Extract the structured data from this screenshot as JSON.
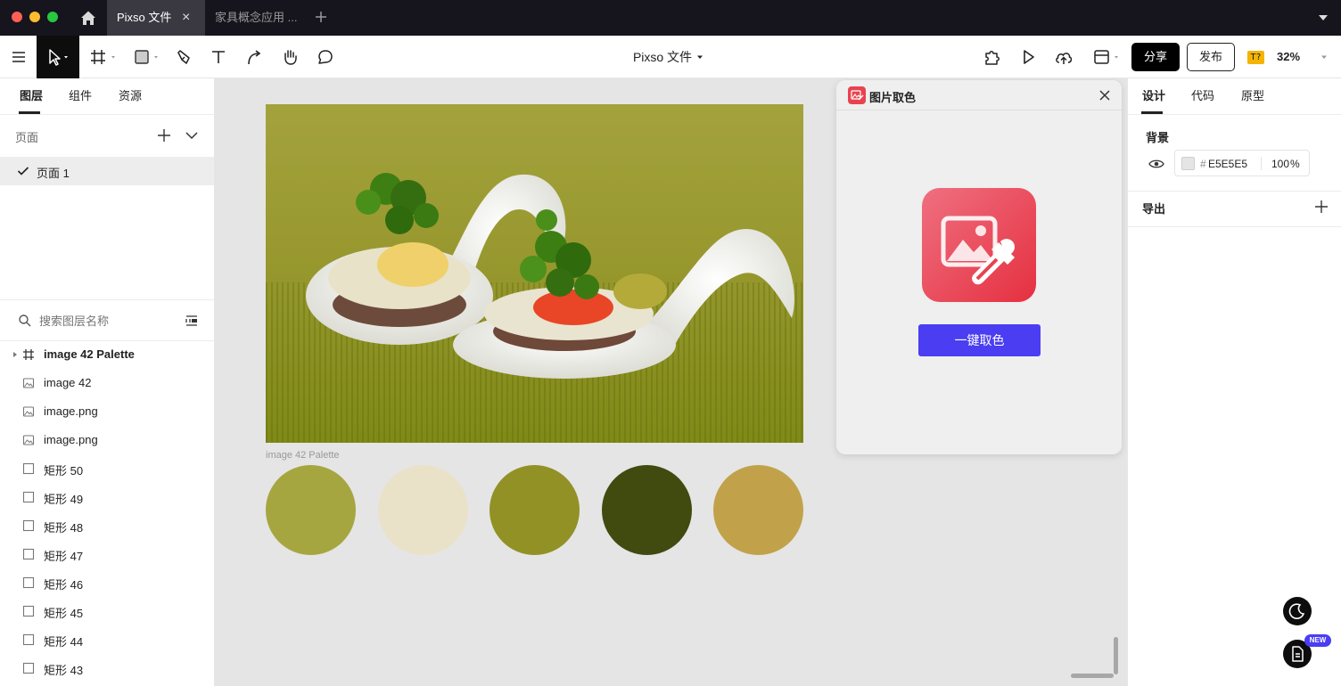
{
  "titlebar": {
    "tabs": [
      {
        "label": "Pixso 文件",
        "active": true
      },
      {
        "label": "家具概念应用 ...",
        "active": false
      }
    ]
  },
  "toolbar": {
    "file_title": "Pixso 文件",
    "share_label": "分享",
    "publish_label": "发布",
    "badge": "T?",
    "zoom": "32%"
  },
  "left_panel": {
    "tabs": [
      "图层",
      "组件",
      "资源"
    ],
    "pages_label": "页面",
    "pages": [
      "页面 1"
    ],
    "search_placeholder": "搜索图层名称",
    "layers": [
      {
        "name": "image 42 Palette",
        "icon": "frame-icon",
        "bold": true,
        "expandable": true
      },
      {
        "name": "image 42",
        "icon": "image-icon"
      },
      {
        "name": "image.png",
        "icon": "image-icon"
      },
      {
        "name": "image.png",
        "icon": "image-icon"
      },
      {
        "name": "矩形 50",
        "icon": "rectangle-icon"
      },
      {
        "name": "矩形 49",
        "icon": "rectangle-icon"
      },
      {
        "name": "矩形 48",
        "icon": "rectangle-icon"
      },
      {
        "name": "矩形 47",
        "icon": "rectangle-icon"
      },
      {
        "name": "矩形 46",
        "icon": "rectangle-icon"
      },
      {
        "name": "矩形 45",
        "icon": "rectangle-icon"
      },
      {
        "name": "矩形 44",
        "icon": "rectangle-icon"
      },
      {
        "name": "矩形 43",
        "icon": "rectangle-icon"
      }
    ]
  },
  "canvas": {
    "frame_label": "image 42 Palette",
    "palette": [
      "#a6a641",
      "#eae1c9",
      "#929126",
      "#414a0f",
      "#c1a24a"
    ]
  },
  "plugin": {
    "title": "图片取色",
    "action_label": "一键取色"
  },
  "right_panel": {
    "tabs": [
      "设计",
      "代码",
      "原型"
    ],
    "background_label": "背景",
    "bg_hash": "#",
    "bg_hex": "E5E5E5",
    "bg_opacity": "100",
    "bg_opacity_unit": "%",
    "export_label": "导出"
  },
  "floating": {
    "new_badge": "NEW"
  },
  "colors": {
    "accent": "#4a3df2",
    "plugin_icon": "#e8434f"
  }
}
